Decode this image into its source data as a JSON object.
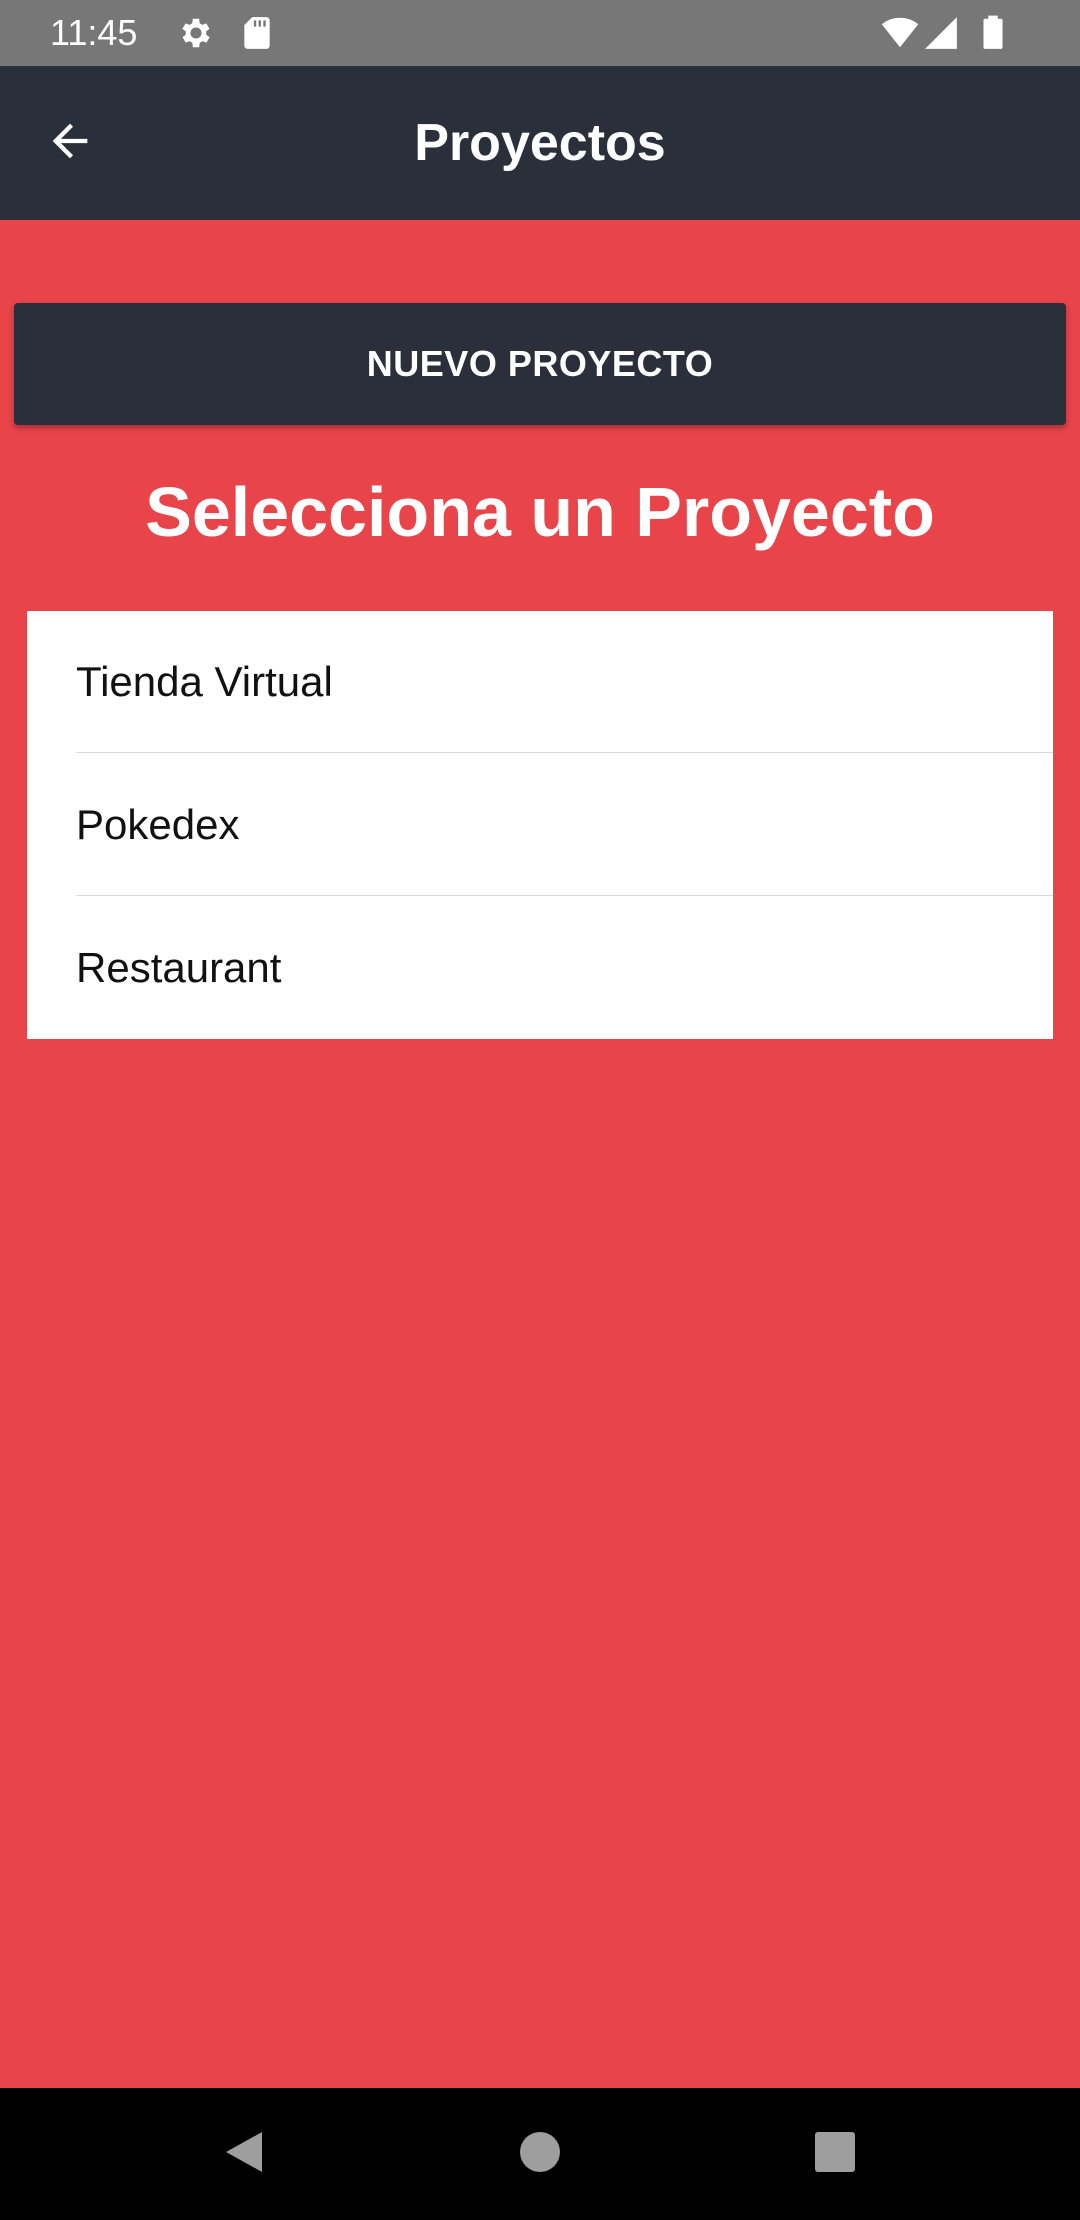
{
  "status_bar": {
    "time": "11:45",
    "icons": [
      "gear-icon",
      "sd-card-icon",
      "wifi-icon",
      "signal-icon",
      "battery-icon"
    ]
  },
  "app_bar": {
    "title": "Proyectos",
    "back_icon": "arrow-left-icon"
  },
  "main": {
    "new_project_label": "NUEVO PROYECTO",
    "heading": "Selecciona un Proyecto",
    "projects": [
      {
        "label": "Tienda Virtual"
      },
      {
        "label": "Pokedex"
      },
      {
        "label": "Restaurant"
      }
    ]
  },
  "nav_bar": {
    "icons": [
      "back-triangle-icon",
      "home-circle-icon",
      "recents-square-icon"
    ]
  },
  "colors": {
    "background": "#e8444a",
    "primary_dark": "#2a2f3a",
    "status_bar": "#777777",
    "list_bg": "#ffffff",
    "nav_bar": "#000000"
  }
}
